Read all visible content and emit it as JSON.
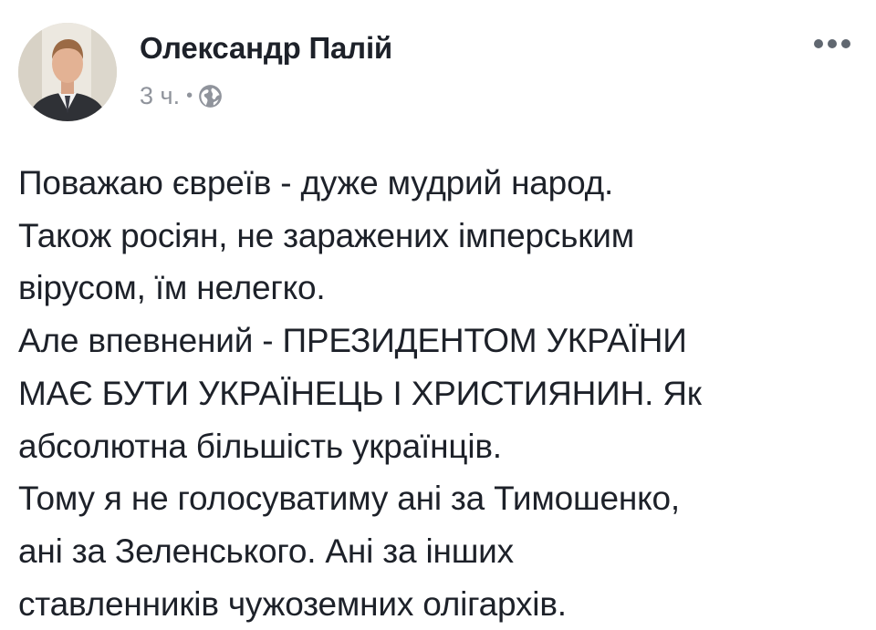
{
  "post": {
    "author": {
      "name": "Олександр Палій"
    },
    "meta": {
      "time": "3 ч.",
      "separator": "•",
      "audience_icon": "globe-icon"
    },
    "menu_icon": "more-options-icon",
    "body_lines": [
      "Поважаю євреїв - дуже мудрий народ.",
      "Також росіян, не заражених імперським",
      "вірусом, їм нелегко.",
      "Але впевнений - ПРЕЗИДЕНТОМ УКРАЇНИ",
      "МАЄ БУТИ УКРАЇНЕЦЬ І ХРИСТИЯНИН. Як",
      "абсолютна більшість українців.",
      "Тому я не голосуватиму ані за Тимошенко,",
      "ані за Зеленського. Ані за інших",
      "ставленників чужоземних олігархів."
    ]
  },
  "colors": {
    "text": "#1d2129",
    "meta": "#90949c",
    "icon": "#606770",
    "background": "#ffffff"
  }
}
